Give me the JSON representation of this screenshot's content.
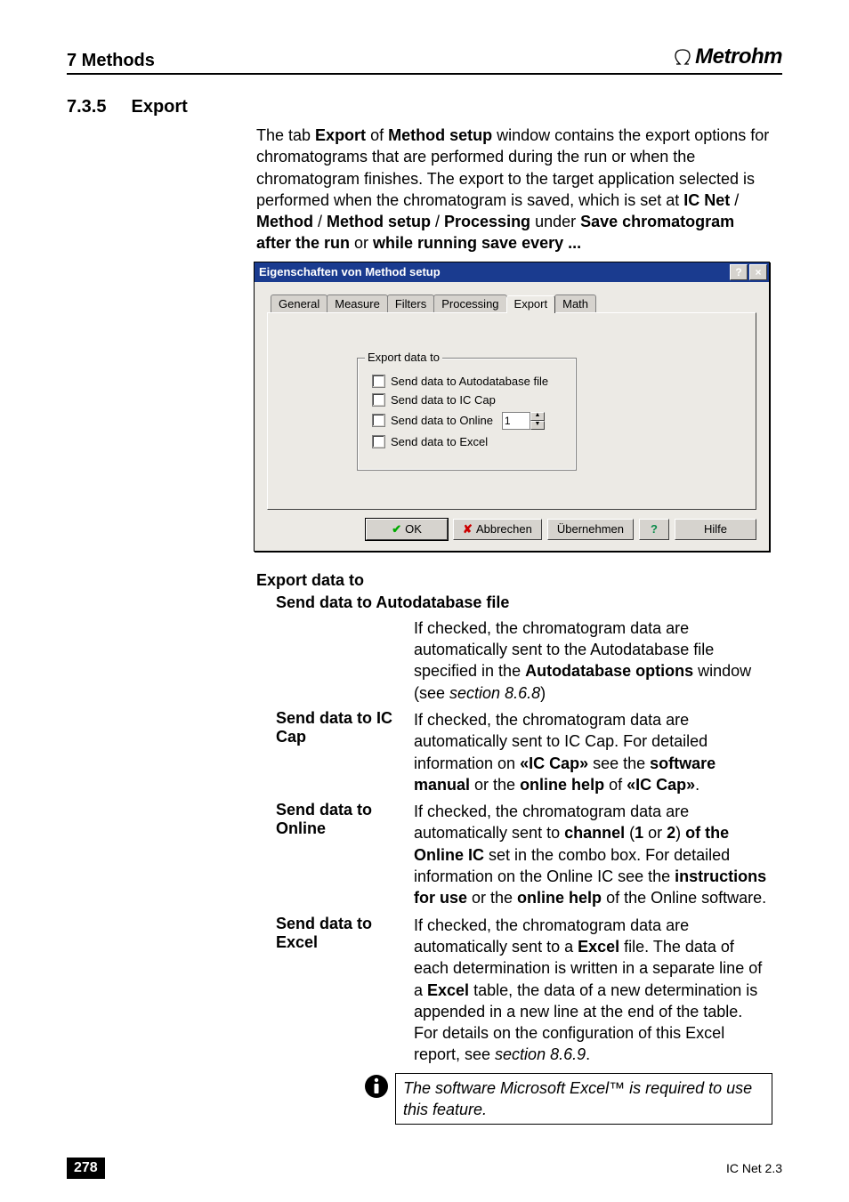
{
  "header": {
    "chapter": "7 Methods",
    "brand": "Metrohm"
  },
  "section": {
    "num": "7.3.5",
    "title": "Export"
  },
  "intro": {
    "run1": "The tab ",
    "b1": "Export",
    "run2": " of ",
    "b2": "Method setup",
    "run3": " window contains the export options for chromatograms that are performed during the run or when the chromatogram finishes. The export to the target application selected is performed when the chromatogram is saved, which is set at ",
    "b3": "IC Net",
    "sep": " / ",
    "b4": "Method",
    "b5": "Method setup",
    "b6": "Processing",
    "run4": " under ",
    "b7": "Save chromatogram after the run",
    "run5": " or ",
    "b8": "while running save every ..."
  },
  "dialog": {
    "title": "Eigenschaften von Method setup",
    "tabs": {
      "general": "General",
      "measure": "Measure",
      "filters": "Filters",
      "processing": "Processing",
      "export": "Export",
      "math": "Math"
    },
    "group_title": "Export data to",
    "chk": {
      "autodb": "Send data to Autodatabase file",
      "iccap": "Send data to IC Cap",
      "online": "Send data to Online",
      "excel": "Send data to Excel"
    },
    "spinner_value": "1",
    "buttons": {
      "ok": "OK",
      "cancel": "Abbrechen",
      "apply": "Übernehmen",
      "help": "Hilfe"
    },
    "win": {
      "help": "?",
      "close": "×"
    }
  },
  "params": {
    "heading": "Export data to",
    "autodb": {
      "key": "Send data to Autodatabase file",
      "p1": "If checked, the chromatogram data are automatically sent to the Autodatabase file specified in the ",
      "b1": "Autodatabase options",
      "p2": " window (see ",
      "i1": "section 8.6.8",
      "p3": ")"
    },
    "iccap": {
      "key": "Send data to IC Cap",
      "p1": "If checked, the chromatogram data are automatically sent to IC Cap. For detailed information on ",
      "b1": "«IC Cap»",
      "p2": " see the ",
      "b2": "software manual",
      "p3": " or the ",
      "b3": "online help",
      "p4": " of ",
      "b4": "«IC Cap»",
      "p5": "."
    },
    "online": {
      "key": "Send data to Online",
      "p1": "If checked, the chromatogram data are automatically sent to ",
      "b1": "channel",
      "p2": " (",
      "b2": "1",
      "p3": " or ",
      "b3": "2",
      "p4": ") ",
      "b4": "of the Online IC",
      "p5": " set in the combo box. For detailed information on the Online IC see the ",
      "b5": "instructions for use",
      "p6": " or the ",
      "b6": "online help",
      "p7": " of the Online software."
    },
    "excel": {
      "key": "Send data to Excel",
      "p1": "If checked, the chromatogram data are automatically sent to a ",
      "b1": "Excel",
      "p2": " file. The data of each determination is written in a separate line of a ",
      "b2": "Excel",
      "p3": " table, the data of a new determination is appended in a new line at the end of the table.",
      "p4": "For details on the configuration of this Excel report, see ",
      "i1": "section 8.6.9",
      "p5": "."
    },
    "note": "The software Microsoft Excel™ is required to use this feature."
  },
  "footer": {
    "page": "278",
    "product": "IC Net 2.3"
  }
}
